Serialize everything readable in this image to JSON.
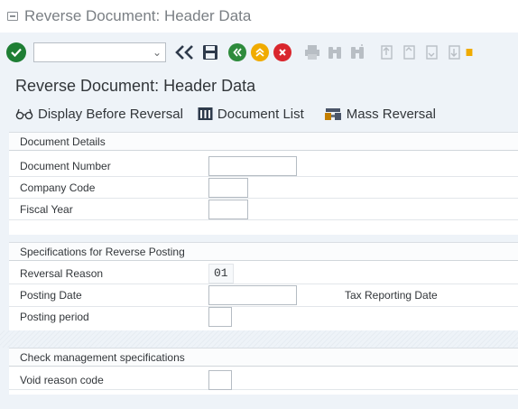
{
  "window": {
    "title": "Reverse Document: Header Data"
  },
  "toolbar": {
    "command_placeholder": "",
    "icons": [
      "enter-icon",
      "command-dropdown",
      "back-double-icon",
      "save-icon",
      "back-icon",
      "exit-icon",
      "cancel-icon",
      "print-icon",
      "find-icon",
      "find-next-icon",
      "first-page-icon",
      "prev-page-icon",
      "next-page-icon",
      "last-page-icon",
      "bookmark-icon"
    ]
  },
  "page": {
    "header": "Reverse Document: Header Data"
  },
  "actions": {
    "display_before": "Display Before Reversal",
    "document_list": "Document List",
    "mass_reversal": "Mass Reversal"
  },
  "document_details": {
    "title": "Document Details",
    "document_number_label": "Document Number",
    "document_number_value": "",
    "company_code_label": "Company Code",
    "company_code_value": "",
    "fiscal_year_label": "Fiscal Year",
    "fiscal_year_value": ""
  },
  "reverse_posting": {
    "title": "Specifications for Reverse Posting",
    "reversal_reason_label": "Reversal Reason",
    "reversal_reason_value": "01",
    "posting_date_label": "Posting Date",
    "posting_date_value": "",
    "tax_reporting_label": "Tax Reporting Date",
    "posting_period_label": "Posting period",
    "posting_period_value": ""
  },
  "check_management": {
    "title": "Check management specifications",
    "void_reason_label": "Void reason code",
    "void_reason_value": ""
  },
  "colors": {
    "background": "#eef3f8",
    "ok_green": "#1e7e34",
    "back_green": "#2e8b3c",
    "exit_orange": "#f0ab00",
    "cancel_red": "#d9262d"
  }
}
